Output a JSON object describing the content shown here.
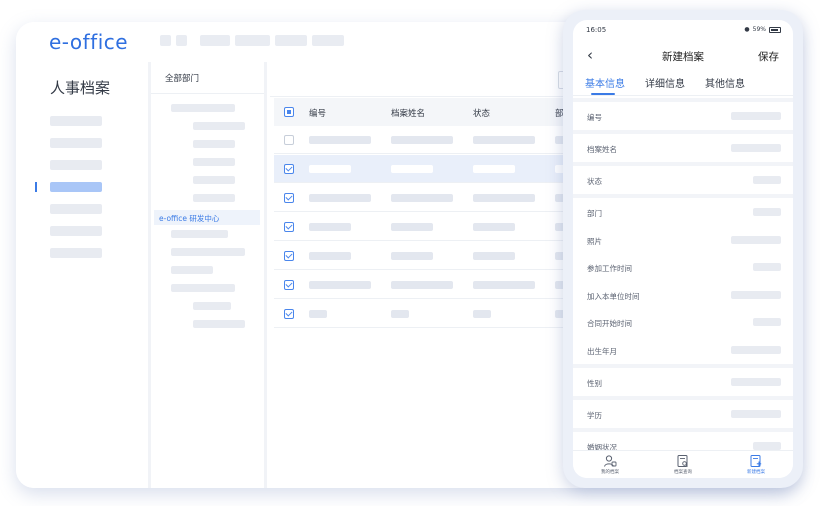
{
  "brand": {
    "logo_text": "e-office",
    "accent": "#3b7be6"
  },
  "sidebar": {
    "module_title": "人事档案"
  },
  "dept_panel": {
    "header": "全部部门",
    "selected_item": "e-office 研发中心"
  },
  "table": {
    "columns": [
      "编号",
      "档案姓名",
      "状态",
      "部"
    ],
    "rows_checked": [
      false,
      true,
      true,
      true,
      true,
      true,
      true
    ],
    "selected_row_index": 1
  },
  "phone": {
    "status": {
      "time": "16:05",
      "battery": "59%"
    },
    "nav": {
      "title": "新建档案",
      "save": "保存",
      "back_icon": "chevron-left-icon"
    },
    "tabs": [
      {
        "label": "基本信息",
        "active": true
      },
      {
        "label": "详细信息",
        "active": false
      },
      {
        "label": "其他信息",
        "active": false
      }
    ],
    "fields": [
      "编号",
      "档案姓名",
      "状态",
      "部门",
      "照片",
      "参加工作时间",
      "加入本单位时间",
      "合同开始时间",
      "出生年月",
      "性别",
      "学历",
      "婚姻状况"
    ],
    "tabbar": [
      {
        "label": "我的档案",
        "icon": "person-icon"
      },
      {
        "label": "档案查询",
        "icon": "file-search-icon"
      },
      {
        "label": "新建档案",
        "icon": "file-add-icon",
        "active": true
      }
    ]
  }
}
